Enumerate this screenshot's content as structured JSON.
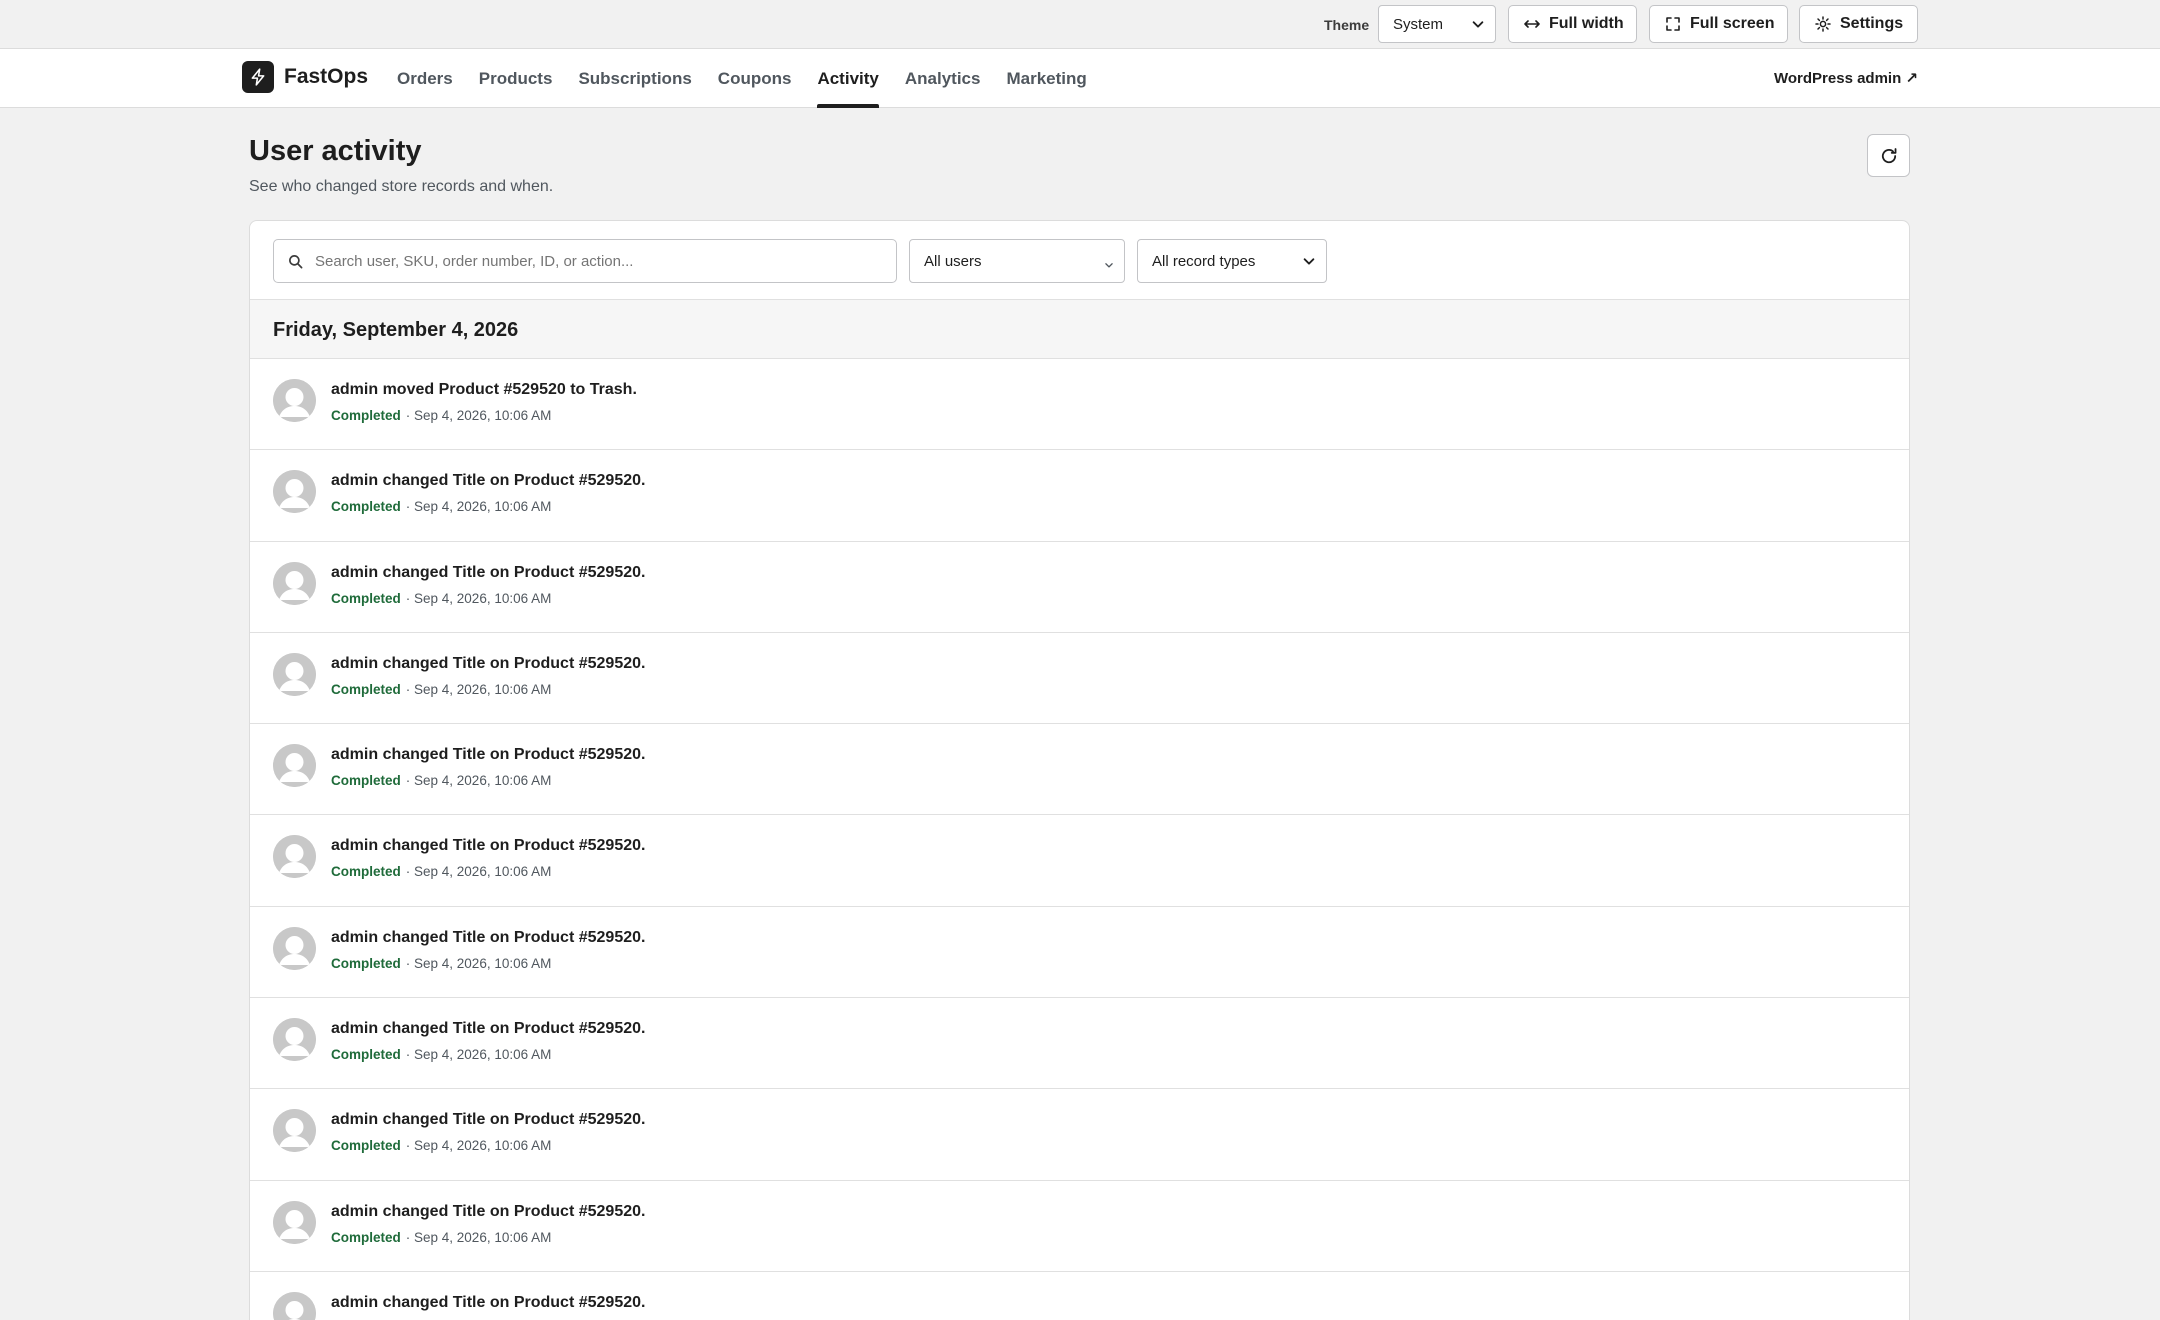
{
  "topbar": {
    "theme_label": "Theme",
    "theme_value": "System",
    "full_width_label": "Full width",
    "full_screen_label": "Full screen",
    "settings_label": "Settings"
  },
  "nav": {
    "brand": "FastOps",
    "items": [
      {
        "label": "Orders",
        "active": false
      },
      {
        "label": "Products",
        "active": false
      },
      {
        "label": "Subscriptions",
        "active": false
      },
      {
        "label": "Coupons",
        "active": false
      },
      {
        "label": "Activity",
        "active": true
      },
      {
        "label": "Analytics",
        "active": false
      },
      {
        "label": "Marketing",
        "active": false
      }
    ],
    "wp_admin_label": "WordPress admin ↗"
  },
  "page": {
    "title": "User activity",
    "subtitle": "See who changed store records and when."
  },
  "filters": {
    "search_placeholder": "Search user, SKU, order number, ID, or action...",
    "users_value": "All users",
    "types_value": "All record types"
  },
  "activity": {
    "date_heading": "Friday, September 4, 2026",
    "rows": [
      {
        "text": "admin moved Product #529520 to Trash.",
        "status": "Completed",
        "time": "· Sep 4, 2026, 10:06 AM"
      },
      {
        "text": "admin changed Title on Product #529520.",
        "status": "Completed",
        "time": "· Sep 4, 2026, 10:06 AM"
      },
      {
        "text": "admin changed Title on Product #529520.",
        "status": "Completed",
        "time": "· Sep 4, 2026, 10:06 AM"
      },
      {
        "text": "admin changed Title on Product #529520.",
        "status": "Completed",
        "time": "· Sep 4, 2026, 10:06 AM"
      },
      {
        "text": "admin changed Title on Product #529520.",
        "status": "Completed",
        "time": "· Sep 4, 2026, 10:06 AM"
      },
      {
        "text": "admin changed Title on Product #529520.",
        "status": "Completed",
        "time": "· Sep 4, 2026, 10:06 AM"
      },
      {
        "text": "admin changed Title on Product #529520.",
        "status": "Completed",
        "time": "· Sep 4, 2026, 10:06 AM"
      },
      {
        "text": "admin changed Title on Product #529520.",
        "status": "Completed",
        "time": "· Sep 4, 2026, 10:06 AM"
      },
      {
        "text": "admin changed Title on Product #529520.",
        "status": "Completed",
        "time": "· Sep 4, 2026, 10:06 AM"
      },
      {
        "text": "admin changed Title on Product #529520.",
        "status": "Completed",
        "time": "· Sep 4, 2026, 10:06 AM"
      },
      {
        "text": "admin changed Title on Product #529520.",
        "status": "",
        "time": ""
      }
    ]
  },
  "colors": {
    "status_completed": "#1f6b3a",
    "nav_active": "#1e1e1e"
  },
  "icons": {
    "full_width": "arrows-horizontal-icon",
    "full_screen": "fullscreen-icon",
    "settings": "gear-icon",
    "refresh": "refresh-icon",
    "search": "search-icon",
    "avatar": "user-avatar-icon"
  }
}
